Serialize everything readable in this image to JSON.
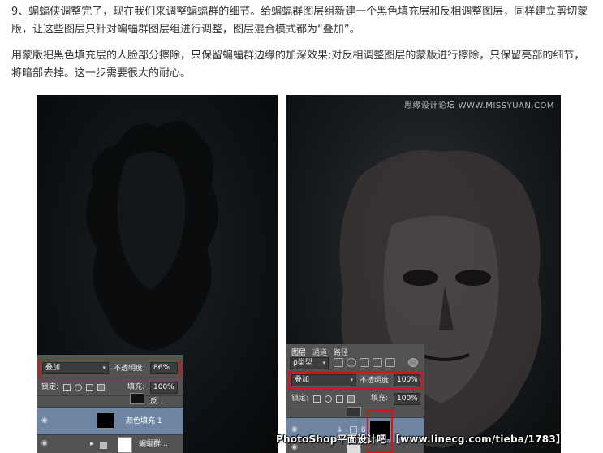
{
  "article": {
    "para1": "9、蝙蝠侠调整完了，现在我们来调整蝙蝠群的细节。给蝙蝠群图层组新建一个黑色填充层和反相调整图层，同样建立剪切蒙版，让这些图层只针对蝙蝠群图层组进行调整，图层混合模式都为“叠加”。",
    "para2": "用蒙版把黑色填充层的人脸部分擦除，只保留蝙蝠群边缘的加深效果;对反相调整图层的蒙版进行擦除，只保留亮部的细节，将暗部去掉。这一步需要很大的耐心。"
  },
  "watermark": "思缘设计论坛 WWW.MISSYUAN.COM",
  "footer_watermark": "PhotoShop平面设计吧 【www.linecg.com/tieba/1783】",
  "left_panel": {
    "blend_mode": "叠加",
    "opacity_label": "不透明度:",
    "opacity_value": "86%",
    "lock_label": "锁定:",
    "fill_label": "填充:",
    "fill_value": "100%",
    "layer_selected_name": "颜色填充 1",
    "layer_group_name": "蝙蝠群...",
    "layer_top_partial": "反..."
  },
  "right_panel": {
    "tabs": [
      "图层",
      "通道",
      "路径"
    ],
    "filter_label": "ρ类型",
    "blend_mode": "叠加",
    "opacity_label": "不透明度:",
    "opacity_value": "100%",
    "lock_label": "锁定:",
    "fill_label": "填充:",
    "fill_value": "100%"
  },
  "colors": {
    "highlight_box": "#d8141b",
    "panel_bg": "#535353",
    "selected_row": "#6e86a4"
  }
}
